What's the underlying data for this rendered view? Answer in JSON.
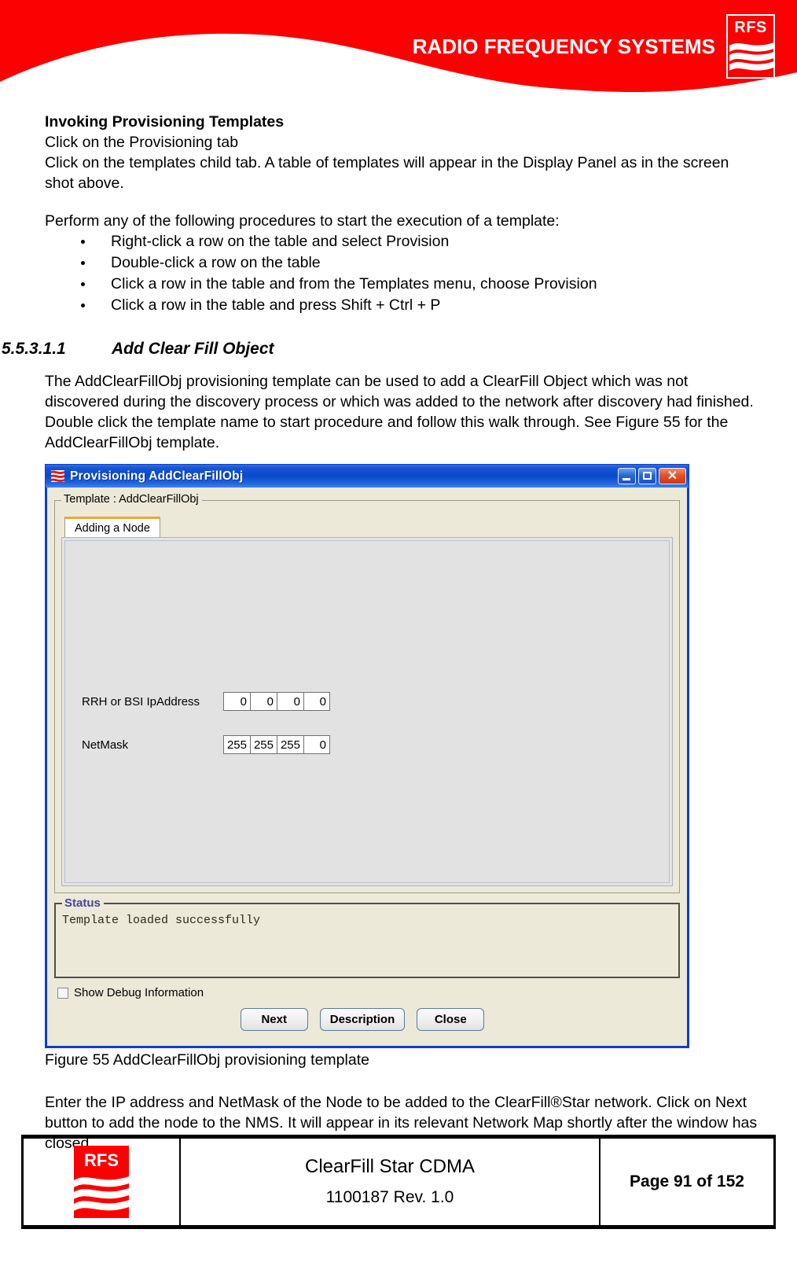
{
  "header": {
    "company_name": "RADIO FREQUENCY SYSTEMS",
    "logo_text": "RFS",
    "banner_color": "#fb0101"
  },
  "body": {
    "section_heading": "Invoking Provisioning Templates",
    "step_1": "Click on the Provisioning tab",
    "step_2": "Click on the templates child tab. A table of templates will appear in the Display Panel as in the screen shot above.",
    "procedures_intro": "Perform any of the following procedures to start the execution of a template:",
    "bullets": [
      "Right-click a row on the table and select Provision",
      "Double-click a row on the table",
      "Click a row in the table and from the Templates menu, choose Provision",
      "Click a row in the table and press Shift + Ctrl + P"
    ],
    "numbered_heading": {
      "number": "5.5.3.1.1",
      "title": "Add Clear Fill Object"
    },
    "description": "The AddClearFillObj provisioning template can be used to add a ClearFill Object which was not discovered during the discovery process or which was added to the network after discovery had finished. Double click the template name to start procedure and follow this walk through. See Figure 55 for the AddClearFillObj template.",
    "figure_caption": "Figure 55 AddClearFillObj provisioning template",
    "closing_paragraph": "Enter the IP address and NetMask of the Node to be added to the ClearFill®Star network. Click on Next button to add the node to the NMS. It will appear in its relevant Network Map shortly after the window has closed."
  },
  "dialog": {
    "title": "Provisioning AddClearFillObj",
    "title_icon": "rfs-waves-icon",
    "window_buttons": {
      "minimize": "minimize-icon",
      "maximize": "maximize-icon",
      "close": "✕"
    },
    "groupbox_legend": "Template : AddClearFillObj",
    "tabs": [
      {
        "label": "Adding a Node",
        "selected": true
      }
    ],
    "fields": [
      {
        "label": "RRH or BSI IpAddress",
        "octets": [
          "0",
          "0",
          "0",
          "0"
        ]
      },
      {
        "label": "NetMask",
        "octets": [
          "255",
          "255",
          "255",
          "0"
        ]
      }
    ],
    "status": {
      "legend": "Status",
      "legend_color": "#44479c",
      "message": "Template loaded successfully"
    },
    "debug_checkbox": {
      "label": "Show Debug Information",
      "checked": false
    },
    "buttons": [
      {
        "label": "Next"
      },
      {
        "label": "Description"
      },
      {
        "label": "Close"
      }
    ]
  },
  "footer": {
    "logo_text": "RFS",
    "document_title": "ClearFill Star CDMA",
    "document_revision": "1100187 Rev. 1.0",
    "page_label": "Page 91 of 152"
  }
}
